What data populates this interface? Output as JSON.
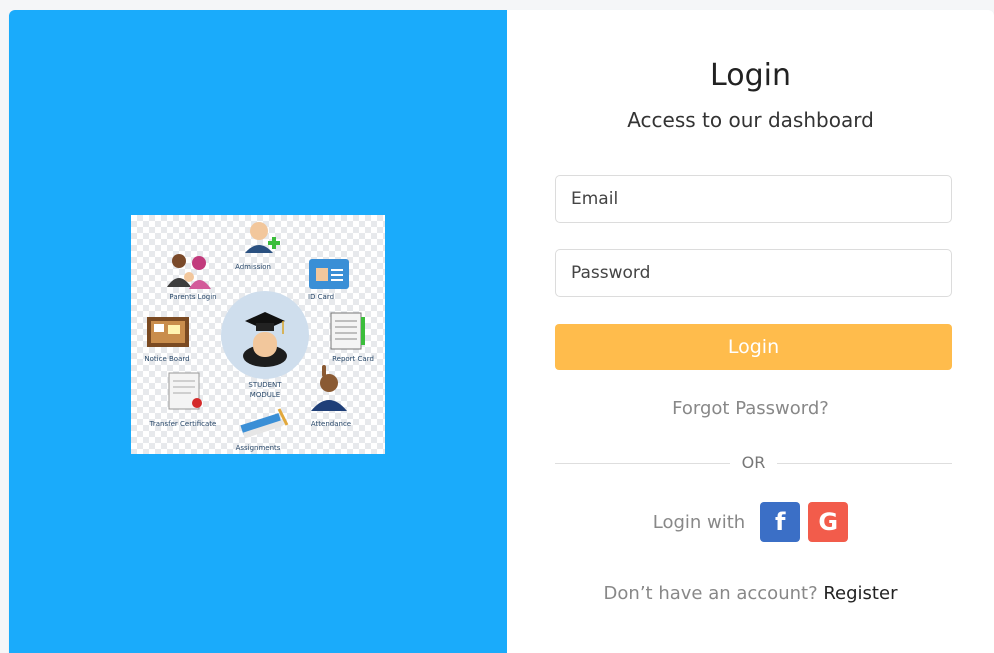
{
  "login": {
    "title": "Login",
    "subtitle": "Access to our dashboard",
    "email_placeholder": "Email",
    "password_placeholder": "Password",
    "login_button": "Login",
    "forgot_password": "Forgot Password?",
    "divider_text": "OR",
    "social_label": "Login with",
    "facebook_letter": "f",
    "google_letter": "G",
    "no_account_text": "Don’t have an account?",
    "register_link": "Register"
  },
  "student_module": {
    "center_label_1": "STUDENT",
    "center_label_2": "MODULE",
    "items": [
      "Admission",
      "ID Card",
      "Report Card",
      "Attendance",
      "Assignments",
      "Transfer Certificate",
      "Notice Board",
      "Parents Login"
    ]
  },
  "colors": {
    "left_panel": "#1aabfb",
    "login_button": "#ffbc4c",
    "facebook": "#3b6fc6",
    "google": "#f25c4b"
  }
}
